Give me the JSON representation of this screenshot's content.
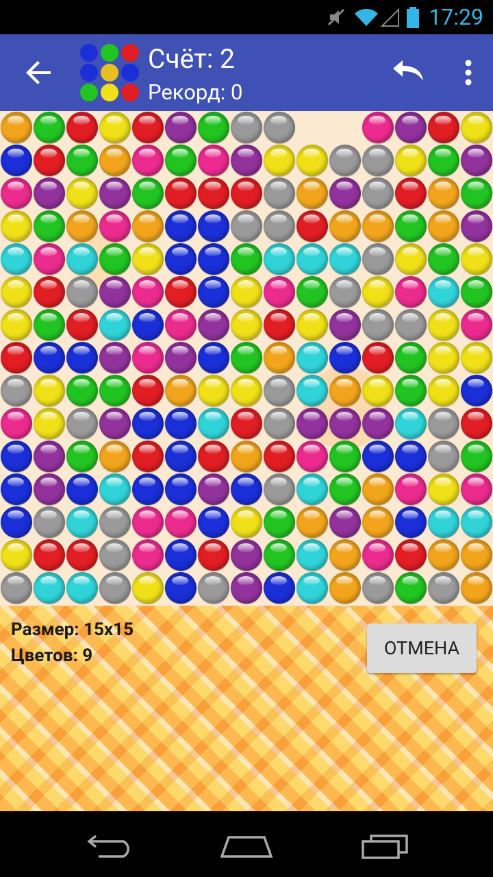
{
  "statusbar": {
    "time": "17:29"
  },
  "header": {
    "score": "Счёт: 2",
    "record": "Рекорд: 0"
  },
  "footer": {
    "size": "Размер: 15x15",
    "colors": "Цветов: 9",
    "cancel_label": "ОТМЕНА"
  },
  "icons": {
    "back": "arrow-back-icon",
    "undo": "undo-icon",
    "menu": "more-vert-icon"
  },
  "palette": {
    "O": "#f2a51c",
    "G": "#22c422",
    "R": "#e01e24",
    "Y": "#f0e018",
    "P": "#ec2b8f",
    "V": "#92329c",
    "S": "#9a9a9a",
    "B": "#1a2fd8",
    "C": "#30d4d8"
  },
  "board": {
    "rows": 15,
    "cols": 15,
    "grid": [
      "OGRYRVGSS..PVRY",
      "BRGOPGPVYYSSYGV",
      "PVYVGRRRSOVSROG",
      "YGOPOBBSSROOGOV",
      "CPCGYBBGCCCSYGY",
      "YRSVPRBYPGSYPCG",
      "YGRCBPVYRYVSSYP",
      "RBBVPVBGOCBRGYY",
      "SYGGROYYSCOYGYB",
      "PYSVBBCRSVVVCSR",
      "BVGORBRORPGBBSG",
      "BVBCBBVBSCGOPYP",
      "BSCSPPBYGOVOBCC",
      "YRRSPBRVGCOPROO",
      "SCCSYBSVBCOSGSO"
    ]
  }
}
